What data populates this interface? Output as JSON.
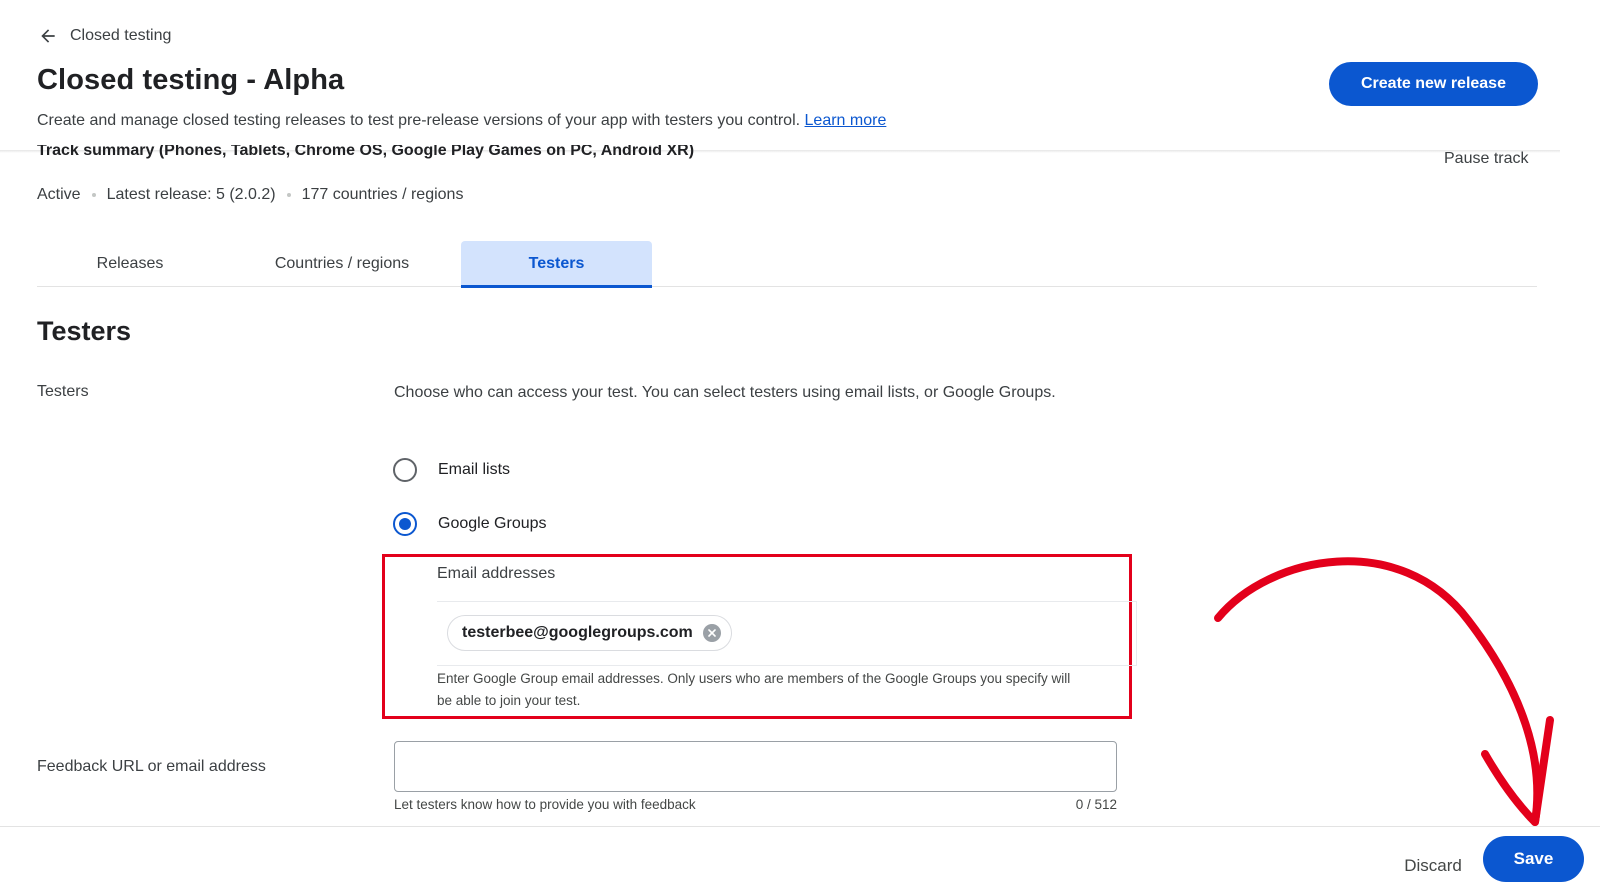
{
  "header": {
    "back_label": "Closed testing",
    "title": "Closed testing - Alpha",
    "subtitle": "Create and manage closed testing releases to test pre-release versions of your app with testers you control.",
    "learn_more": "Learn more",
    "create_release": "Create new release"
  },
  "track": {
    "summary": "Track summary (Phones, Tablets, Chrome OS, Google Play Games on PC, Android XR)",
    "pause": "Pause track",
    "status": "Active",
    "latest_release": "Latest release: 5 (2.0.2)",
    "countries": "177 countries / regions"
  },
  "tabs": [
    {
      "label": "Releases",
      "active": false
    },
    {
      "label": "Countries / regions",
      "active": false
    },
    {
      "label": "Testers",
      "active": true
    }
  ],
  "testers": {
    "section_title": "Testers",
    "label": "Testers",
    "description": "Choose who can access your test. You can select testers using email lists, or Google Groups.",
    "options": [
      {
        "label": "Email lists",
        "checked": false
      },
      {
        "label": "Google Groups",
        "checked": true
      }
    ],
    "email_label": "Email addresses",
    "emails": [
      "testerbee@googlegroups.com"
    ],
    "email_helper": "Enter Google Group email addresses. Only users who are members of the Google Groups you specify will be able to join your test."
  },
  "feedback": {
    "label": "Feedback URL or email address",
    "value": "",
    "helper": "Let testers know how to provide you with feedback",
    "counter": "0 / 512"
  },
  "footer": {
    "discard": "Discard",
    "save": "Save"
  },
  "colors": {
    "primary": "#0b57d0",
    "tab_active_bg": "#d3e3fd",
    "annotation_red": "#e3001b"
  }
}
